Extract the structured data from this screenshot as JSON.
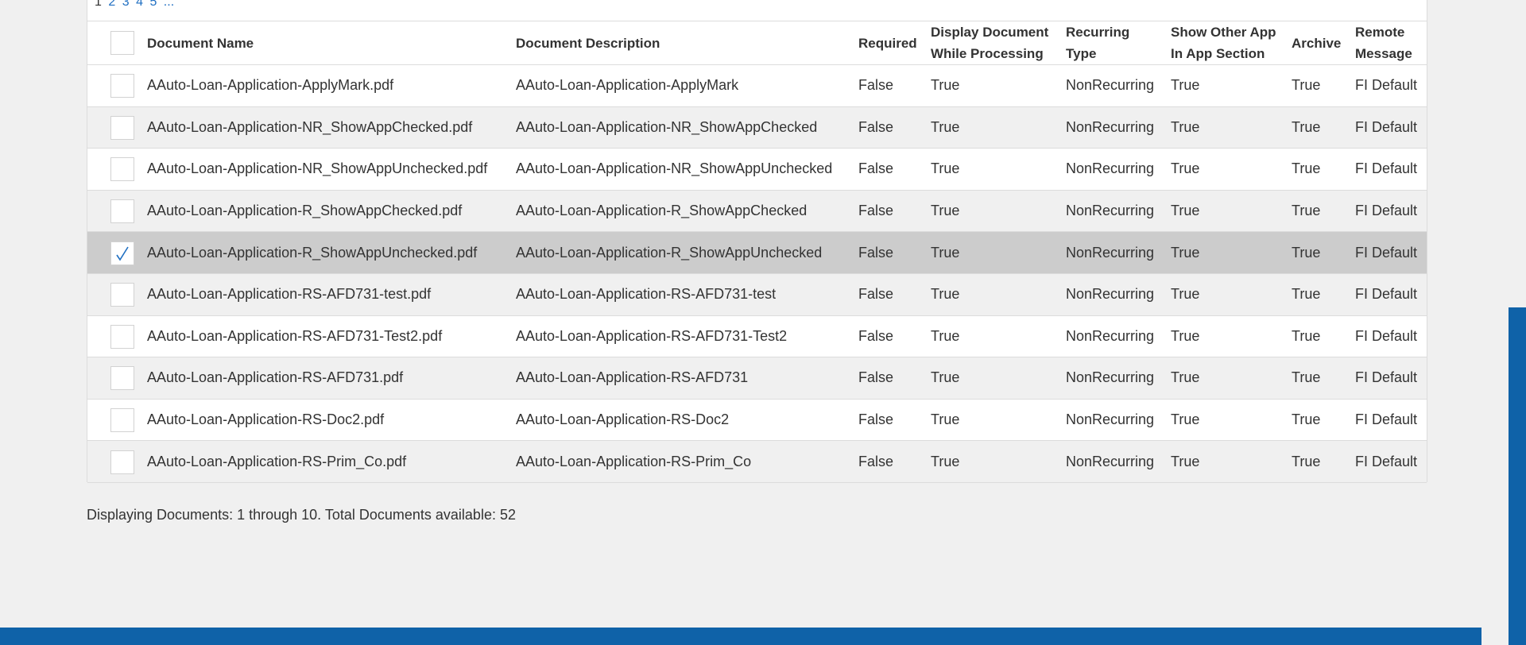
{
  "pager": {
    "current": "1",
    "pages": [
      "2",
      "3",
      "4",
      "5"
    ],
    "more": "..."
  },
  "table": {
    "columns": {
      "name": "Document Name",
      "description": "Document Description",
      "required": "Required",
      "display_line1": "Display Document",
      "display_line2": "While Processing",
      "recurring_line1": "Recurring",
      "recurring_line2": "Type",
      "show_line1": "Show Other App",
      "show_line2": "In App Section",
      "archive": "Archive",
      "remote_line1": "Remote",
      "remote_line2": "Message"
    },
    "rows": [
      {
        "name": "AAuto-Loan-Application-ApplyMark.pdf",
        "description": "AAuto-Loan-Application-ApplyMark",
        "required": "False",
        "display": "True",
        "recurring": "NonRecurring",
        "show": "True",
        "archive": "True",
        "remote": "FI Default",
        "checked": false
      },
      {
        "name": "AAuto-Loan-Application-NR_ShowAppChecked.pdf",
        "description": "AAuto-Loan-Application-NR_ShowAppChecked",
        "required": "False",
        "display": "True",
        "recurring": "NonRecurring",
        "show": "True",
        "archive": "True",
        "remote": "FI Default",
        "checked": false
      },
      {
        "name": "AAuto-Loan-Application-NR_ShowAppUnchecked.pdf",
        "description": "AAuto-Loan-Application-NR_ShowAppUnchecked",
        "required": "False",
        "display": "True",
        "recurring": "NonRecurring",
        "show": "True",
        "archive": "True",
        "remote": "FI Default",
        "checked": false
      },
      {
        "name": "AAuto-Loan-Application-R_ShowAppChecked.pdf",
        "description": "AAuto-Loan-Application-R_ShowAppChecked",
        "required": "False",
        "display": "True",
        "recurring": "NonRecurring",
        "show": "True",
        "archive": "True",
        "remote": "FI Default",
        "checked": false
      },
      {
        "name": "AAuto-Loan-Application-R_ShowAppUnchecked.pdf",
        "description": "AAuto-Loan-Application-R_ShowAppUnchecked",
        "required": "False",
        "display": "True",
        "recurring": "NonRecurring",
        "show": "True",
        "archive": "True",
        "remote": "FI Default",
        "checked": true
      },
      {
        "name": "AAuto-Loan-Application-RS-AFD731-test.pdf",
        "description": "AAuto-Loan-Application-RS-AFD731-test",
        "required": "False",
        "display": "True",
        "recurring": "NonRecurring",
        "show": "True",
        "archive": "True",
        "remote": "FI Default",
        "checked": false
      },
      {
        "name": "AAuto-Loan-Application-RS-AFD731-Test2.pdf",
        "description": "AAuto-Loan-Application-RS-AFD731-Test2",
        "required": "False",
        "display": "True",
        "recurring": "NonRecurring",
        "show": "True",
        "archive": "True",
        "remote": "FI Default",
        "checked": false
      },
      {
        "name": "AAuto-Loan-Application-RS-AFD731.pdf",
        "description": "AAuto-Loan-Application-RS-AFD731",
        "required": "False",
        "display": "True",
        "recurring": "NonRecurring",
        "show": "True",
        "archive": "True",
        "remote": "FI Default",
        "checked": false
      },
      {
        "name": "AAuto-Loan-Application-RS-Doc2.pdf",
        "description": "AAuto-Loan-Application-RS-Doc2",
        "required": "False",
        "display": "True",
        "recurring": "NonRecurring",
        "show": "True",
        "archive": "True",
        "remote": "FI Default",
        "checked": false
      },
      {
        "name": "AAuto-Loan-Application-RS-Prim_Co.pdf",
        "description": "AAuto-Loan-Application-RS-Prim_Co",
        "required": "False",
        "display": "True",
        "recurring": "NonRecurring",
        "show": "True",
        "archive": "True",
        "remote": "FI Default",
        "checked": false
      }
    ]
  },
  "footer": {
    "summary": "Displaying Documents: 1 through 10. Total Documents available: 52"
  },
  "colors": {
    "accent": "#0f62a8",
    "link": "#1f6fc2",
    "zebra": "#f0f0f0",
    "selected": "#cccccc"
  }
}
